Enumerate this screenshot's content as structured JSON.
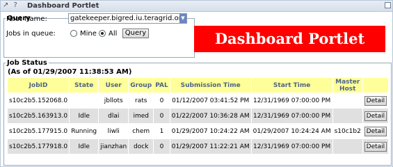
{
  "titlebar": {
    "icons": "↗ ?",
    "title": "Dashboard Portlet"
  },
  "banner": "Dashboard Portlet",
  "query": {
    "legend": "Query",
    "host_label": "Host Name:",
    "host_value": "gatekeeper.bigred.iu.teragrid.org",
    "jobs_label": "Jobs in queue:",
    "option_mine": "Mine",
    "option_all": "All",
    "selected": "All",
    "button": "Query"
  },
  "status": {
    "legend": "Job Status",
    "as_of": "(As of 01/29/2007 11:38:53 AM)",
    "columns": [
      "JobID",
      "State",
      "User",
      "Group",
      "PAL",
      "Submission Time",
      "Start Time",
      "Master Host",
      ""
    ],
    "rows": [
      {
        "jobid": "s10c2b5.152068.0",
        "state": "",
        "user": "jbllots",
        "group": "rats",
        "pal": "0",
        "submit": "01/12/2007 03:41:52 PM",
        "start": "12/31/1969 07:00:00 PM",
        "host": "",
        "action": "Detail"
      },
      {
        "jobid": "s10c2b5.163913.0",
        "state": "Idle",
        "user": "dlai",
        "group": "imed",
        "pal": "0",
        "submit": "01/22/2007 10:36:28 AM",
        "start": "12/31/1969 07:00:00 PM",
        "host": "",
        "action": "Detail"
      },
      {
        "jobid": "s10c2b5.177915.0",
        "state": "Running",
        "user": "liwli",
        "group": "chem",
        "pal": "1",
        "submit": "01/29/2007 10:24:22 AM",
        "start": "01/29/2007 10:24:24 AM",
        "host": "s10c1b2",
        "action": "Detail"
      },
      {
        "jobid": "s10c2b5.177918.0",
        "state": "Idle",
        "user": "jianzhan",
        "group": "dock",
        "pal": "0",
        "submit": "01/29/2007 11:22:21 AM",
        "start": "12/31/1969 07:00:00 PM",
        "host": "",
        "action": "Detail"
      }
    ]
  },
  "colors": {
    "header_bg": "#ffff99",
    "header_text": "#4c6488",
    "banner_bg": "#ff0000",
    "row_alt": "#e0e0e0"
  }
}
